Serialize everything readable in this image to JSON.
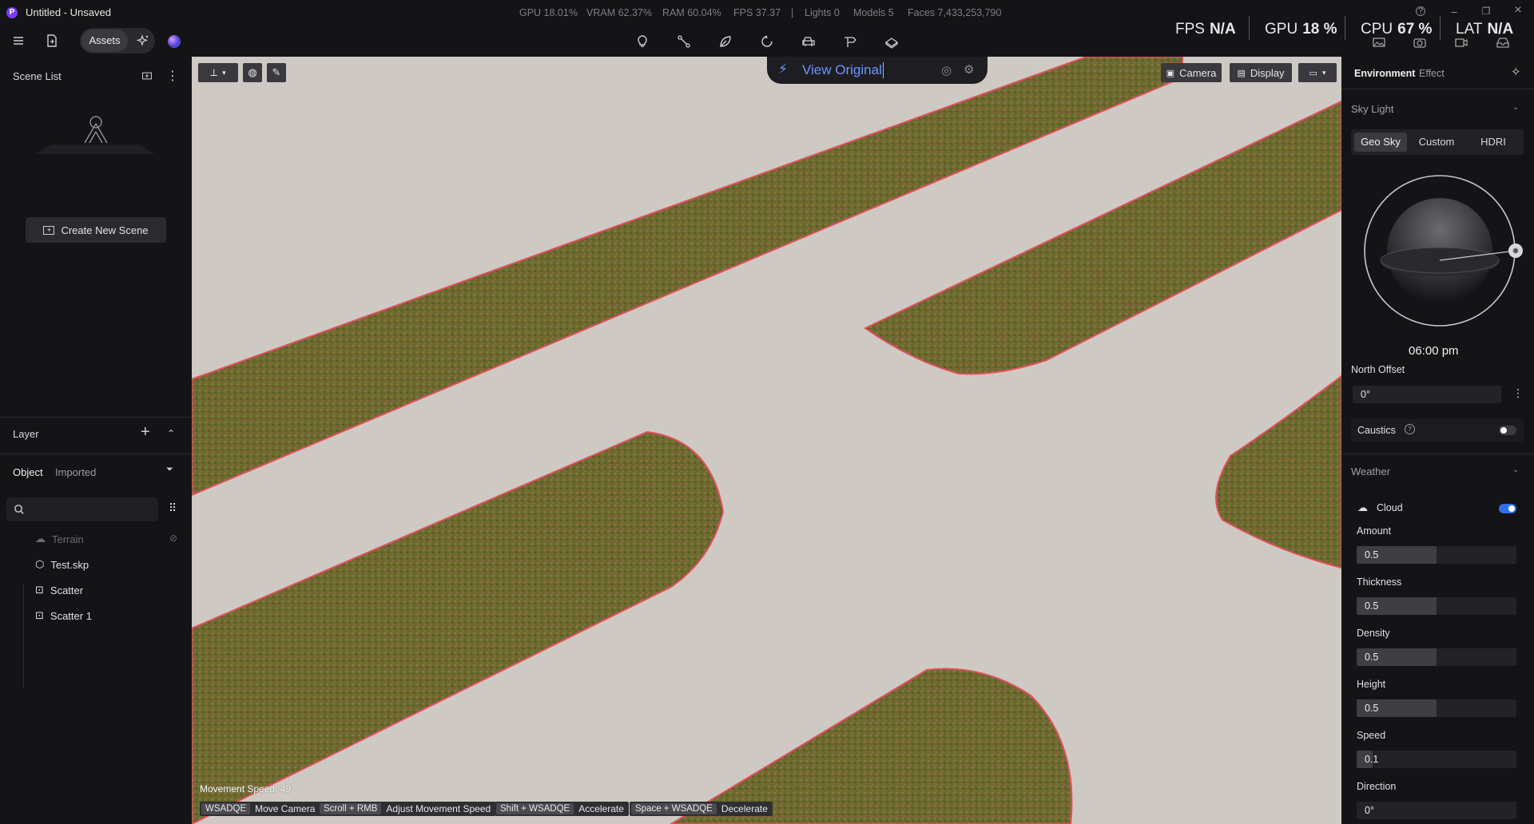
{
  "window": {
    "title": "Untitled - Unsaved",
    "logo_letter": "P",
    "stats": {
      "gpu": "GPU 18.01%",
      "vram": "VRAM 62.37%",
      "ram": "RAM 60.04%",
      "fps": "FPS 37.37",
      "separator": "|",
      "lights": "Lights 0",
      "models": "Models 5",
      "faces": "Faces 7,433,253,790"
    }
  },
  "toolbar": {
    "assets_label": "Assets",
    "tools": [
      "light-bulb-icon",
      "path-icon",
      "leaf-icon",
      "rotate-icon",
      "car-icon",
      "signpost-icon",
      "terrain-icon"
    ]
  },
  "perf": {
    "fps_label": "FPS",
    "fps_value": "N/A",
    "gpu_label": "GPU",
    "gpu_value": "18 %",
    "cpu_label": "CPU",
    "cpu_value": "67 %",
    "lat_label": "LAT",
    "lat_value": "N/A"
  },
  "left_panel": {
    "scene_list_title": "Scene List",
    "create_scene_label": "Create New Scene",
    "layer_title": "Layer",
    "tabs": {
      "object": "Object",
      "imported": "Imported"
    },
    "search_placeholder": "",
    "tree": [
      {
        "label": "Terrain",
        "icon": "terrain-icon",
        "hidden": true
      },
      {
        "label": "Test.skp",
        "icon": "cube-icon",
        "hidden": false
      },
      {
        "label": "Scatter",
        "icon": "scatter-icon",
        "hidden": false
      },
      {
        "label": "Scatter 1",
        "icon": "scatter-icon",
        "hidden": false
      }
    ]
  },
  "viewport": {
    "view_original_label": "View Original",
    "camera_label": "Camera",
    "display_label": "Display",
    "movement_speed": "Movement Speed: 49",
    "hints": [
      {
        "key": "WSADQE",
        "action": "Move Camera"
      },
      {
        "key": "Scroll + RMB",
        "action": "Adjust Movement Speed"
      },
      {
        "key": "Shift + WSADQE",
        "action": "Accelerate"
      },
      {
        "key": "Space + WSADQE",
        "action": "Decelerate"
      }
    ],
    "colors": {
      "ground": "#cfc9c3",
      "grass": "#6b6a2e",
      "edge": "#e0505e"
    }
  },
  "right_panel": {
    "tabs": {
      "environment": "Environment",
      "effect": "Effect"
    },
    "sky_light_title": "Sky Light",
    "sky_modes": [
      "Geo Sky",
      "Custom",
      "HDRI"
    ],
    "sky_mode_active": "Geo Sky",
    "time": "06:00 pm",
    "north_offset_label": "North Offset",
    "north_offset_value": "0°",
    "caustics_label": "Caustics",
    "caustics_on": false,
    "weather_title": "Weather",
    "cloud_label": "Cloud",
    "cloud_on": true,
    "props": [
      {
        "label": "Amount",
        "value": "0.5",
        "fraction": 0.5
      },
      {
        "label": "Thickness",
        "value": "0.5",
        "fraction": 0.5
      },
      {
        "label": "Density",
        "value": "0.5",
        "fraction": 0.5
      },
      {
        "label": "Height",
        "value": "0.5",
        "fraction": 0.5
      },
      {
        "label": "Speed",
        "value": "0.1",
        "fraction": 0.1
      },
      {
        "label": "Direction",
        "value": "0°",
        "fraction": 0
      }
    ],
    "accent": "#2f6fe8"
  }
}
